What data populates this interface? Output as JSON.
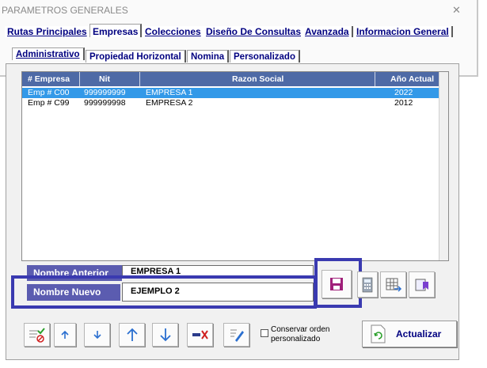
{
  "window": {
    "title": "PARAMETROS GENERALES",
    "close_icon": "close-icon"
  },
  "tabs_main": [
    {
      "label": "Rutas Principales",
      "active": false
    },
    {
      "label": "Empresas",
      "active": true
    },
    {
      "label": "Colecciones",
      "active": false
    },
    {
      "label": "Diseño De Consultas",
      "active": false
    },
    {
      "label": "Avanzada",
      "active": false
    },
    {
      "label": "Informacion General",
      "active": false
    }
  ],
  "tabs_sub": [
    {
      "label": "Administrativo",
      "active": true
    },
    {
      "label": "Propiedad Horizontal",
      "active": false
    },
    {
      "label": "Nomina",
      "active": false
    },
    {
      "label": "Personalizado",
      "active": false
    }
  ],
  "table": {
    "columns": [
      "# Empresa",
      "Nit",
      "Razon Social",
      "Año Actual"
    ],
    "rows": [
      {
        "empresa": "Emp # C00",
        "nit": "999999999",
        "razon": "EMPRESA 1",
        "anio": "2022",
        "selected": true
      },
      {
        "empresa": "Emp # C99",
        "nit": "999999998",
        "razon": "EMPRESA 2",
        "anio": "2012",
        "selected": false
      }
    ]
  },
  "form": {
    "old_name_label": "Nombre Anterior",
    "old_name_value": "EMPRESA 1",
    "new_name_label": "Nombre Nuevo",
    "new_name_value": "EJEMPLO 2"
  },
  "toolbar": {
    "keep_order_label": "Conservar orden personalizado",
    "update_label": "Actualizar"
  },
  "colors": {
    "label_bg": "#5b5cb0",
    "header_bg": "#4e6aa6",
    "selected_row": "#3399e8",
    "highlight": "#3a3ab0",
    "save_icon": "#a0207a"
  }
}
